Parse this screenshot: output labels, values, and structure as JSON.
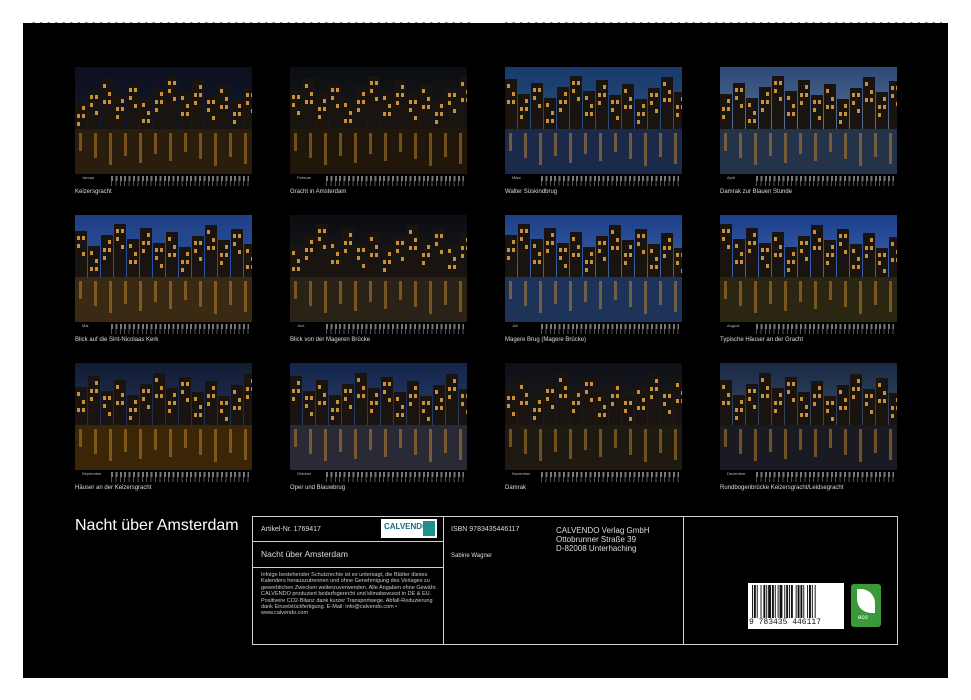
{
  "calendar": {
    "title": "Nacht über Amsterdam",
    "months": [
      {
        "label": "Januar",
        "caption": "Keizersgracht"
      },
      {
        "label": "Februar",
        "caption": "Gracht in Amsterdam"
      },
      {
        "label": "März",
        "caption": "Walter Süskindbrug"
      },
      {
        "label": "April",
        "caption": "Damrak zur Blauen Stunde"
      },
      {
        "label": "Mai",
        "caption": "Blick auf die Sint-Nicolaas Kerk"
      },
      {
        "label": "Juni",
        "caption": "Blick von der Mageren Brücke"
      },
      {
        "label": "Juli",
        "caption": "Magere Brug (Magere Brücke)"
      },
      {
        "label": "August",
        "caption": "Typische Häuser an der Gracht"
      },
      {
        "label": "September",
        "caption": "Häuser an der Keizersgracht"
      },
      {
        "label": "Oktober",
        "caption": "Oper und Blauwbrug"
      },
      {
        "label": "November",
        "caption": "Damrak"
      },
      {
        "label": "Dezember",
        "caption": "Rundbogenbrücke Keizersgracht/Leidsegracht"
      }
    ]
  },
  "info": {
    "article": "Artikel-Nr. 1769417",
    "subtitle": "Nacht über Amsterdam",
    "isbn": "ISBN 9783435446117",
    "author": "Sabine Wagner",
    "publisher": [
      "CALVENDO Verlag GmbH",
      "Ottobrunner Straße 39",
      "D-82008 Unterhaching"
    ],
    "legal": "Infolge bestehender Schutzrechte ist es untersagt, die Blätter dieses Kalenders herauszutrennen und ohne Genehmigung des Verlages zu gewerblichen Zwecken weiterzuverwenden. Alle Angaben ohne Gewähr. CALVENDO produziert bedarfsgerecht und klimabewusst in DE & EU. Positivere CO2-Bilanz dank kurzer Transportwege. Abfall-Reduzierung dank Einzelstückfertigung. E-Mail: info@calvendo.com • www.calvendo.com",
    "logo_text": "CALVENDO",
    "barcode_number": "9 783435 446117",
    "eco_label": "eco"
  },
  "colors": {
    "background": "#000000",
    "text": "#dddddd",
    "eco": "#3a9a3a"
  }
}
